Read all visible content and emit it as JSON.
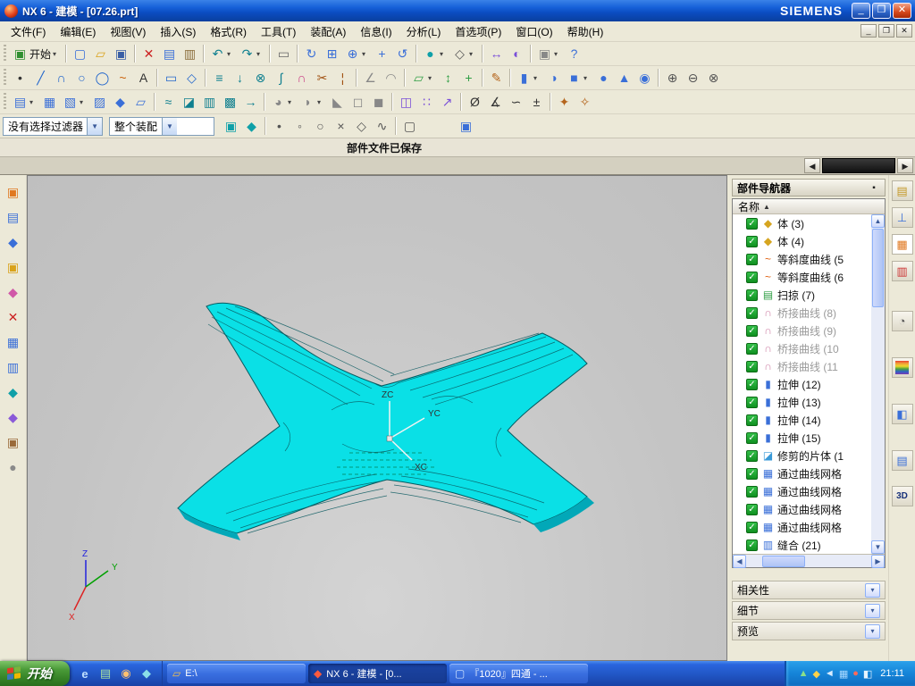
{
  "titlebar": {
    "title": "NX 6 - 建模 - [07.26.prt]",
    "brand": "SIEMENS"
  },
  "menubar": {
    "items": [
      {
        "id": "file",
        "label": "文件(F)"
      },
      {
        "id": "edit",
        "label": "编辑(E)"
      },
      {
        "id": "view",
        "label": "视图(V)"
      },
      {
        "id": "insert",
        "label": "插入(S)"
      },
      {
        "id": "format",
        "label": "格式(R)"
      },
      {
        "id": "tools",
        "label": "工具(T)"
      },
      {
        "id": "assemblies",
        "label": "装配(A)"
      },
      {
        "id": "information",
        "label": "信息(I)"
      },
      {
        "id": "analysis",
        "label": "分析(L)"
      },
      {
        "id": "preferences",
        "label": "首选项(P)"
      },
      {
        "id": "window",
        "label": "窗口(O)"
      },
      {
        "id": "help",
        "label": "帮助(H)"
      }
    ]
  },
  "toolbars": {
    "row1": [
      {
        "n": "start-menu",
        "g": "▣",
        "c": "#2f8f2f",
        "label": "开始",
        "a": 1
      },
      {
        "sep": 1
      },
      {
        "n": "new",
        "g": "▢",
        "c": "#3a6fd8"
      },
      {
        "n": "open",
        "g": "▱",
        "c": "#d9a21b"
      },
      {
        "n": "save",
        "g": "▣",
        "c": "#3a5fa5"
      },
      {
        "sep": 1
      },
      {
        "n": "cut",
        "g": "✕",
        "c": "#cc2222"
      },
      {
        "n": "copy",
        "g": "▤",
        "c": "#3a6fd8"
      },
      {
        "n": "paste",
        "g": "▥",
        "c": "#8a6d3b"
      },
      {
        "sep": 1
      },
      {
        "n": "undo",
        "g": "↶",
        "c": "#0e7f8f",
        "a": 1
      },
      {
        "n": "redo",
        "g": "↷",
        "c": "#0e7f8f",
        "a": 1
      },
      {
        "sep": 1
      },
      {
        "n": "plot",
        "g": "▭",
        "c": "#666666"
      },
      {
        "sep": 1
      },
      {
        "n": "refresh",
        "g": "↻",
        "c": "#3a6fd8"
      },
      {
        "n": "fit-view",
        "g": "⊞",
        "c": "#3a6fd8"
      },
      {
        "n": "zoom",
        "g": "⊕",
        "c": "#3a6fd8",
        "a": 1
      },
      {
        "n": "pan",
        "g": "+",
        "c": "#3a6fd8"
      },
      {
        "n": "rotate",
        "g": "↺",
        "c": "#3a6fd8"
      },
      {
        "sep": 1
      },
      {
        "n": "shaded",
        "g": "●",
        "c": "#0fa0a8",
        "a": 1
      },
      {
        "n": "wireframe",
        "g": "◇",
        "c": "#555555",
        "a": 1
      },
      {
        "sep": 1
      },
      {
        "n": "move-object",
        "g": "↔",
        "c": "#7a4fd8"
      },
      {
        "n": "show-hide",
        "g": "◐",
        "c": "#7a4fd8"
      },
      {
        "sep": 1
      },
      {
        "n": "window",
        "g": "▣",
        "c": "#888888",
        "a": 1
      },
      {
        "n": "help",
        "g": "?",
        "c": "#3a6fd8"
      }
    ],
    "row2": [
      {
        "n": "point",
        "g": "•",
        "c": "#333333"
      },
      {
        "n": "line",
        "g": "╱",
        "c": "#2266cc"
      },
      {
        "n": "arc",
        "g": "∩",
        "c": "#2266cc"
      },
      {
        "n": "circle",
        "g": "○",
        "c": "#2266cc"
      },
      {
        "n": "ellipse",
        "g": "◯",
        "c": "#2266cc"
      },
      {
        "n": "spline",
        "g": "~",
        "c": "#cc6610"
      },
      {
        "n": "text",
        "g": "A",
        "c": "#333333"
      },
      {
        "sep": 1
      },
      {
        "n": "rectangle",
        "g": "▭",
        "c": "#2266cc"
      },
      {
        "n": "polygon",
        "g": "◇",
        "c": "#2266cc"
      },
      {
        "sep": 1
      },
      {
        "n": "offset-curve",
        "g": "≡",
        "c": "#0e7f8f"
      },
      {
        "n": "project-curve",
        "g": "↓",
        "c": "#0e7f8f"
      },
      {
        "n": "intersection-curve",
        "g": "⊗",
        "c": "#0e7f8f"
      },
      {
        "n": "section-curve",
        "g": "∫",
        "c": "#0e7f8f"
      },
      {
        "n": "bridge-curve",
        "g": "∩",
        "c": "#cc4488"
      },
      {
        "n": "trim-curve",
        "g": "✂",
        "c": "#a05010"
      },
      {
        "n": "divide-curve",
        "g": "¦",
        "c": "#a05010"
      },
      {
        "sep": 1
      },
      {
        "n": "chamfer-curve",
        "g": "∠",
        "c": "#888888"
      },
      {
        "n": "fillet-curve",
        "g": "◠",
        "c": "#888888"
      },
      {
        "sep": 1
      },
      {
        "n": "datum-plane",
        "g": "▱",
        "c": "#2f9e44",
        "a": 1
      },
      {
        "n": "datum-axis",
        "g": "↕",
        "c": "#2f9e44"
      },
      {
        "n": "datum-csys",
        "g": "+",
        "c": "#2f9e44"
      },
      {
        "sep": 1
      },
      {
        "n": "sketch",
        "g": "✎",
        "c": "#b5651d"
      },
      {
        "sep": 1
      },
      {
        "n": "extrude",
        "g": "▮",
        "c": "#3a6fd8",
        "a": 1
      },
      {
        "n": "revolve",
        "g": "◑",
        "c": "#3a6fd8"
      },
      {
        "n": "block",
        "g": "■",
        "c": "#3a6fd8",
        "a": 1
      },
      {
        "n": "cylinder",
        "g": "●",
        "c": "#3a6fd8"
      },
      {
        "n": "cone",
        "g": "▲",
        "c": "#3a6fd8"
      },
      {
        "n": "sphere",
        "g": "◉",
        "c": "#3a6fd8"
      },
      {
        "sep": 1
      },
      {
        "n": "unite",
        "g": "⊕",
        "c": "#555555"
      },
      {
        "n": "subtract",
        "g": "⊖",
        "c": "#555555"
      },
      {
        "n": "intersect",
        "g": "⊗",
        "c": "#555555"
      }
    ],
    "row3": [
      {
        "n": "through-curves",
        "g": "▤",
        "c": "#3a6fd8",
        "a": 1
      },
      {
        "n": "through-curve-mesh",
        "g": "▦",
        "c": "#3a6fd8"
      },
      {
        "n": "swept",
        "g": "▧",
        "c": "#3a6fd8",
        "a": 1
      },
      {
        "n": "ruled",
        "g": "▨",
        "c": "#3a6fd8"
      },
      {
        "n": "n-sided-surface",
        "g": "◆",
        "c": "#3a6fd8"
      },
      {
        "n": "bounded-plane",
        "g": "▱",
        "c": "#3a6fd8"
      },
      {
        "sep": 1
      },
      {
        "n": "offset-surface",
        "g": "≈",
        "c": "#0e7f8f"
      },
      {
        "n": "trimmed-sheet",
        "g": "◪",
        "c": "#0e7f8f"
      },
      {
        "n": "sew",
        "g": "▥",
        "c": "#0e7f8f"
      },
      {
        "n": "patch",
        "g": "▩",
        "c": "#0e7f8f"
      },
      {
        "n": "extension",
        "g": "→",
        "c": "#0e7f8f"
      },
      {
        "sep": 1
      },
      {
        "n": "face-blend",
        "g": "◕",
        "c": "#888888",
        "a": 1
      },
      {
        "n": "edge-blend",
        "g": "◗",
        "c": "#888888",
        "a": 1
      },
      {
        "n": "chamfer",
        "g": "◣",
        "c": "#888888"
      },
      {
        "n": "shell",
        "g": "◻",
        "c": "#888888"
      },
      {
        "n": "thicken",
        "g": "◼",
        "c": "#888888"
      },
      {
        "sep": 1
      },
      {
        "n": "mirror-body",
        "g": "◫",
        "c": "#7a4fd8"
      },
      {
        "n": "pattern-feature",
        "g": "∷",
        "c": "#7a4fd8"
      },
      {
        "n": "scale-body",
        "g": "↗",
        "c": "#7a4fd8"
      },
      {
        "sep": 1
      },
      {
        "n": "measure",
        "g": "Ø",
        "c": "#333333"
      },
      {
        "n": "angle-analysis",
        "g": "∡",
        "c": "#333333"
      },
      {
        "n": "reflection-analysis",
        "g": "∽",
        "c": "#333333"
      },
      {
        "n": "deviation",
        "g": "±",
        "c": "#333333"
      },
      {
        "sep": 1
      },
      {
        "n": "x-form",
        "g": "✦",
        "c": "#b5651d"
      },
      {
        "n": "i-form",
        "g": "✧",
        "c": "#b5651d"
      }
    ]
  },
  "selection_bar": {
    "filter": "没有选择过滤器",
    "scope": "整个装配",
    "icons": [
      {
        "n": "filter-face",
        "g": "▣",
        "c": "#0fa0a8"
      },
      {
        "n": "filter-body",
        "g": "◆",
        "c": "#0fa0a8"
      },
      {
        "sep": 1
      },
      {
        "n": "snap-endpoint",
        "g": "•",
        "c": "#555555"
      },
      {
        "n": "snap-midpoint",
        "g": "◦",
        "c": "#555555"
      },
      {
        "n": "snap-center",
        "g": "○",
        "c": "#555555"
      },
      {
        "n": "snap-intersection",
        "g": "×",
        "c": "#555555"
      },
      {
        "n": "snap-quadrant",
        "g": "◇",
        "c": "#555555"
      },
      {
        "n": "snap-point-on-curve",
        "g": "∿",
        "c": "#555555"
      },
      {
        "sep": 1
      },
      {
        "n": "rectangle-select",
        "g": "▢",
        "c": "#555555"
      },
      {
        "gap": 1
      },
      {
        "n": "quick-pick",
        "g": "▣",
        "c": "#3a6fd8"
      }
    ]
  },
  "prompt": "部件文件已保存",
  "left_toolbar": [
    {
      "n": "left-tool-1",
      "g": "▣",
      "c": "#e07820"
    },
    {
      "n": "left-tool-2",
      "g": "▤",
      "c": "#3a6fd8"
    },
    {
      "n": "left-tool-3",
      "g": "◆",
      "c": "#3a6fd8"
    },
    {
      "n": "left-tool-4",
      "g": "▣",
      "c": "#d9a21b"
    },
    {
      "n": "left-tool-5",
      "g": "◆",
      "c": "#d058a8"
    },
    {
      "n": "left-tool-6",
      "g": "✕",
      "c": "#cc2222"
    },
    {
      "n": "left-tool-7",
      "g": "▦",
      "c": "#3a6fd8"
    },
    {
      "n": "left-tool-8",
      "g": "▥",
      "c": "#3a6fd8"
    },
    {
      "n": "left-tool-9",
      "g": "◆",
      "c": "#0fa0a8"
    },
    {
      "n": "left-tool-10",
      "g": "◆",
      "c": "#8a5ad8"
    },
    {
      "n": "left-tool-11",
      "g": "▣",
      "c": "#9a6a3a"
    },
    {
      "n": "left-tool-12",
      "g": "●",
      "c": "#8a8a8a"
    }
  ],
  "resource_tabs": [
    {
      "n": "assembly-navigator",
      "g": "▤",
      "c": "#c49a2a"
    },
    {
      "n": "constraint-navigator",
      "g": "⊥",
      "c": "#3a6fd8"
    },
    {
      "n": "part-navigator",
      "g": "▦",
      "c": "#e07820",
      "active": 1
    },
    {
      "n": "operation-navigator",
      "g": "▥",
      "c": "#cc3333"
    },
    {
      "n": "history",
      "g": "◔",
      "c": "#555555",
      "gap": 26
    },
    {
      "n": "palettes",
      "grad": 1,
      "gap": 22
    },
    {
      "n": "materials",
      "g": "◧",
      "c": "#3a6fd8",
      "gap": 22
    },
    {
      "n": "layers",
      "g": "▤",
      "c": "#3a6fd8",
      "gap": 22
    },
    {
      "n": "hd3d",
      "text": "3D",
      "gap": 10
    }
  ],
  "navigator": {
    "title": "部件导航器",
    "header": "名称",
    "items": [
      {
        "label": "体 (3)",
        "icon": "body",
        "g": "◆",
        "c": "#d6a520"
      },
      {
        "label": "体 (4)",
        "icon": "body",
        "g": "◆",
        "c": "#d6a520"
      },
      {
        "label": "等斜度曲线 (5",
        "icon": "isocline-curve",
        "g": "~",
        "c": "#e06010"
      },
      {
        "label": "等斜度曲线 (6",
        "icon": "isocline-curve",
        "g": "~",
        "c": "#e06010"
      },
      {
        "label": "扫掠 (7)",
        "icon": "sweep",
        "g": "▤",
        "c": "#2f9e44"
      },
      {
        "label": "桥接曲线 (8)",
        "icon": "bridge-curve",
        "g": "∩",
        "c": "#d084a8",
        "dim": 1
      },
      {
        "label": "桥接曲线 (9)",
        "icon": "bridge-curve",
        "g": "∩",
        "c": "#d084a8",
        "dim": 1
      },
      {
        "label": "桥接曲线 (10",
        "icon": "bridge-curve",
        "g": "∩",
        "c": "#d084a8",
        "dim": 1
      },
      {
        "label": "桥接曲线 (11",
        "icon": "bridge-curve",
        "g": "∩",
        "c": "#d084a8",
        "dim": 1
      },
      {
        "label": "拉伸 (12)",
        "icon": "extrude",
        "g": "▮",
        "c": "#3a6fd8"
      },
      {
        "label": "拉伸 (13)",
        "icon": "extrude",
        "g": "▮",
        "c": "#3a6fd8"
      },
      {
        "label": "拉伸 (14)",
        "icon": "extrude",
        "g": "▮",
        "c": "#3a6fd8"
      },
      {
        "label": "拉伸 (15)",
        "icon": "extrude",
        "g": "▮",
        "c": "#3a6fd8"
      },
      {
        "label": "修剪的片体 (1",
        "icon": "trimmed-sheet",
        "g": "◪",
        "c": "#3a9ad8"
      },
      {
        "label": "通过曲线网格",
        "icon": "through-curve-mesh",
        "g": "▦",
        "c": "#3a6fd8"
      },
      {
        "label": "通过曲线网格",
        "icon": "through-curve-mesh",
        "g": "▦",
        "c": "#3a6fd8"
      },
      {
        "label": "通过曲线网格",
        "icon": "through-curve-mesh",
        "g": "▦",
        "c": "#3a6fd8"
      },
      {
        "label": "通过曲线网格",
        "icon": "through-curve-mesh",
        "g": "▦",
        "c": "#3a6fd8"
      },
      {
        "label": "缝合 (21)",
        "icon": "sew",
        "g": "▥",
        "c": "#3a6fd8"
      }
    ],
    "panels": [
      {
        "id": "dependencies",
        "label": "相关性"
      },
      {
        "id": "details",
        "label": "细节"
      },
      {
        "id": "preview",
        "label": "预览"
      }
    ]
  },
  "viewport": {
    "axis_labels": {
      "z": "ZC",
      "y": "YC",
      "x": "XC"
    },
    "mini_axis": {
      "z": "Z",
      "y": "Y",
      "x": "X"
    }
  },
  "model": {
    "fill": "#0ae0e6",
    "dark": "#02a8b8",
    "edge": "#045a60"
  },
  "taskbar": {
    "start_label": "开始",
    "quick_launch": [
      {
        "n": "internet-explorer",
        "g": "e",
        "c": "#bfe0ff"
      },
      {
        "n": "show-desktop",
        "g": "▤",
        "c": "#a8e0a0"
      },
      {
        "n": "media-player",
        "g": "◉",
        "c": "#ffc070"
      },
      {
        "n": "messenger",
        "g": "◆",
        "c": "#8adfe8"
      }
    ],
    "tasks": [
      {
        "id": "explorer",
        "label": "E:\\",
        "g": "▱",
        "c": "#f2c14e"
      },
      {
        "id": "nx",
        "label": "NX 6 - 建模 - [0...",
        "g": "◆",
        "c": "#ff5a3c",
        "active": 1
      },
      {
        "id": "document",
        "label": "『1020』四通 - ...",
        "g": "▢",
        "c": "#cfe2ff"
      }
    ],
    "tray_icons": [
      {
        "n": "tray-antivirus",
        "g": "▲",
        "c": "#8ae08a"
      },
      {
        "n": "tray-update",
        "g": "◆",
        "c": "#ffd24a"
      },
      {
        "n": "tray-volume",
        "g": "◄",
        "c": "#d8ecff"
      },
      {
        "n": "tray-network",
        "g": "▦",
        "c": "#a8d8ff"
      },
      {
        "n": "tray-im",
        "g": "●",
        "c": "#ff6a5a"
      },
      {
        "n": "tray-ime",
        "g": "◧",
        "c": "#e8f4ff"
      }
    ],
    "time": "21:11"
  }
}
